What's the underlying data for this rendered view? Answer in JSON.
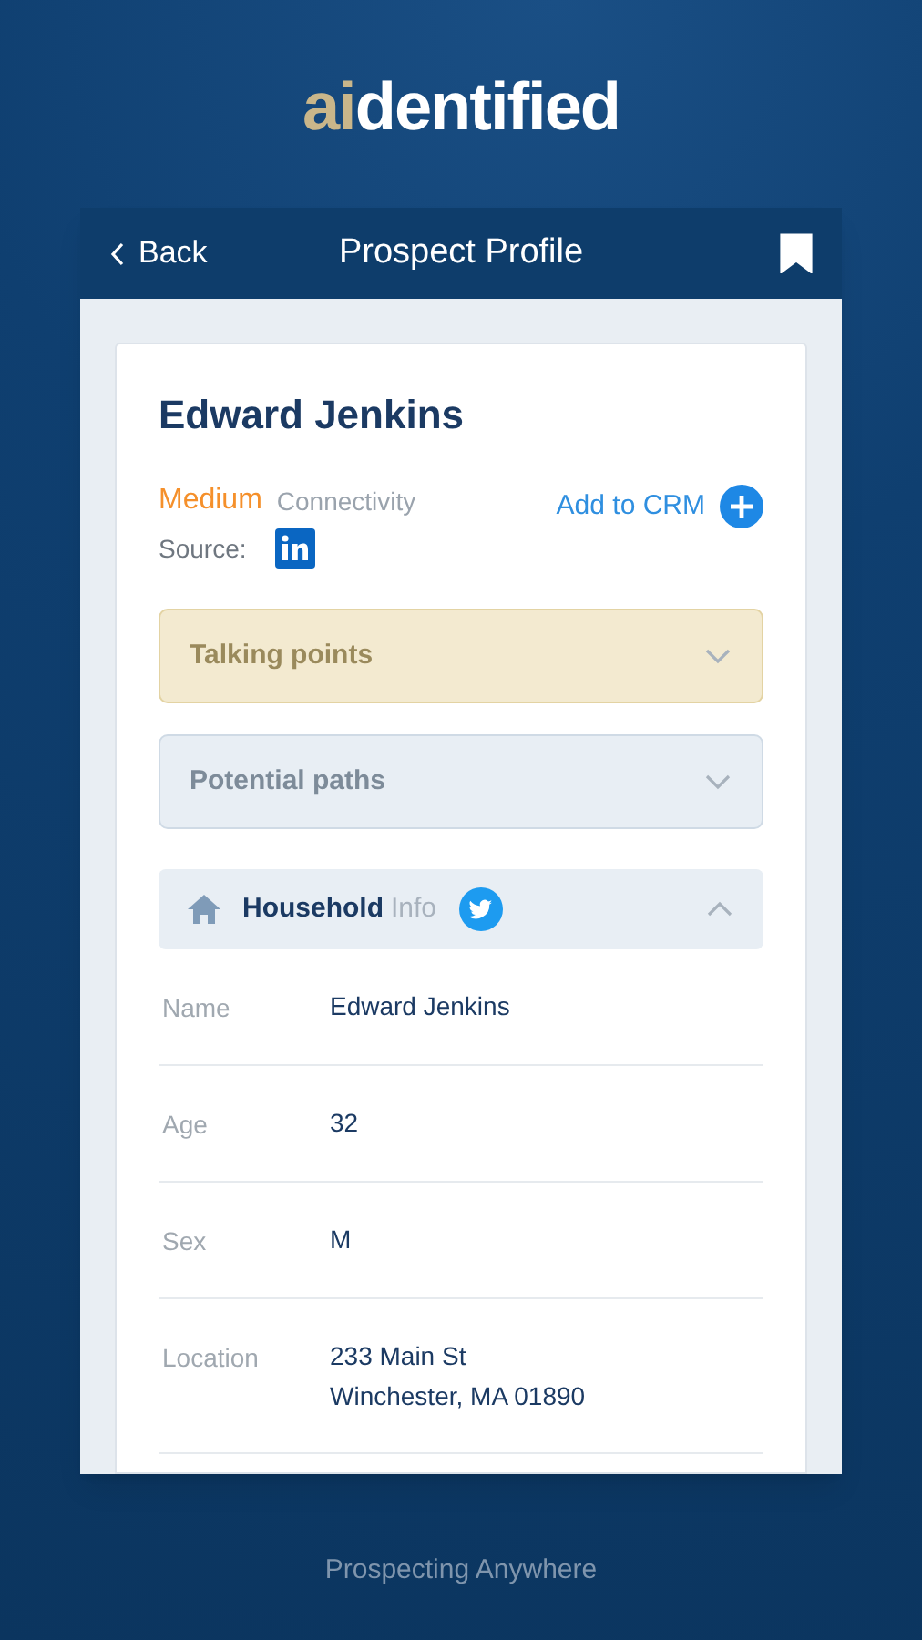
{
  "logo": {
    "accent": "ai",
    "rest": "dentified"
  },
  "header": {
    "back": "Back",
    "title": "Prospect Profile",
    "bookmarked": true
  },
  "profile": {
    "name": "Edward Jenkins",
    "connectivity_level": "Medium",
    "connectivity_label": "Connectivity",
    "add_to_crm": "Add to CRM",
    "source_label": "Source:"
  },
  "sections": [
    {
      "kind": "highlight",
      "title": "Talking points",
      "expanded": false
    },
    {
      "kind": "plain",
      "title": "Potential paths",
      "expanded": false
    }
  ],
  "household": {
    "title": "Household",
    "subtitle": "Info",
    "expanded": true,
    "fields": [
      {
        "label": "Name",
        "value": [
          "Edward Jenkins"
        ]
      },
      {
        "label": "Age",
        "value": [
          "32"
        ]
      },
      {
        "label": "Sex",
        "value": [
          "M"
        ]
      },
      {
        "label": "Location",
        "value": [
          "233 Main St",
          "Winchester, MA 01890"
        ]
      }
    ]
  },
  "footer": "Prospecting Anywhere"
}
